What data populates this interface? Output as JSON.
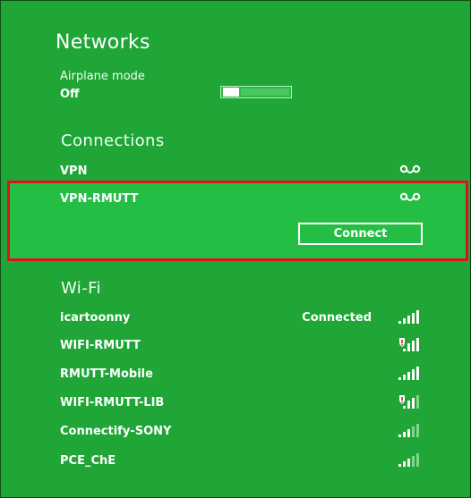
{
  "panel": {
    "title": "Networks",
    "airplane_mode": {
      "label": "Airplane mode",
      "state": "Off"
    }
  },
  "connections": {
    "title": "Connections",
    "items": [
      {
        "label": "VPN",
        "icon": "vpn-icon"
      },
      {
        "label": "VPN-RMUTT",
        "icon": "vpn-icon",
        "selected": true,
        "action_label": "Connect"
      }
    ]
  },
  "wifi": {
    "title": "Wi-Fi",
    "items": [
      {
        "label": "icartoonny",
        "status": "Connected",
        "icon": "wifi-signal-icon",
        "secured": false
      },
      {
        "label": "WIFI-RMUTT",
        "status": "",
        "icon": "wifi-signal-shield-icon",
        "secured": true
      },
      {
        "label": "RMUTT-Mobile",
        "status": "",
        "icon": "wifi-signal-icon",
        "secured": false
      },
      {
        "label": "WIFI-RMUTT-LIB",
        "status": "",
        "icon": "wifi-signal-shield-icon",
        "secured": true
      },
      {
        "label": "Connectify-SONY",
        "status": "",
        "icon": "wifi-signal-icon",
        "secured": false
      },
      {
        "label": "PCE_ChE",
        "status": "",
        "icon": "wifi-signal-icon",
        "secured": false
      }
    ]
  },
  "colors": {
    "panel_background": "#1fa637",
    "selected_background": "#25be45",
    "highlight_border": "#e10f1d",
    "text": "#ffffff"
  }
}
